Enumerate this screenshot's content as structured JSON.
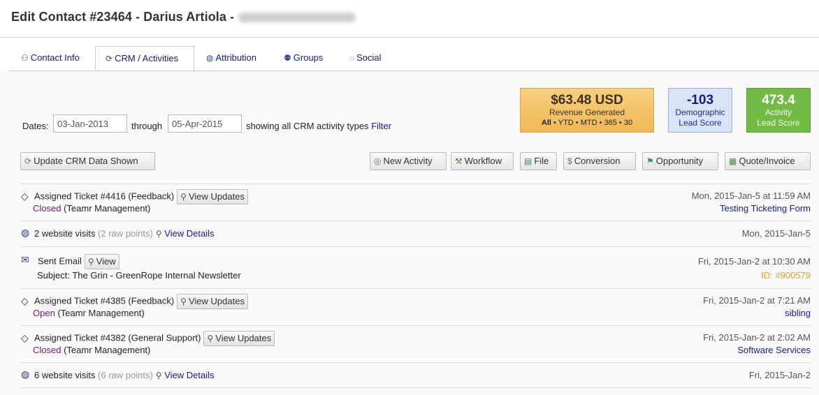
{
  "page": {
    "title": "Edit Contact #23464 - Darius Artiola -"
  },
  "tabs": [
    {
      "label": "Contact Info",
      "icon": "person-icon",
      "active": false
    },
    {
      "label": "CRM / Activities",
      "icon": "crm-icon",
      "active": true
    },
    {
      "label": "Attribution",
      "icon": "globe-icon",
      "active": false
    },
    {
      "label": "Groups",
      "icon": "group-icon",
      "active": false
    },
    {
      "label": "Social",
      "icon": "chat-icon",
      "active": false
    }
  ],
  "stats": {
    "revenue": {
      "value": "$63.48 USD",
      "label": "Revenue Generated",
      "periods_all": "All",
      "periods_rest": "• YTD • MTD • 365 • 30"
    },
    "demographic": {
      "value": "-103",
      "line1": "Demographic",
      "line2": "Lead Score"
    },
    "activity": {
      "value": "473.4",
      "line1": "Activity",
      "line2": "Lead Score"
    }
  },
  "filter": {
    "dates_label": "Dates:",
    "from": "03-Jan-2013",
    "through_label": "through",
    "to": "05-Apr-2015",
    "showing": "showing all CRM activity types",
    "filter_link": "Filter"
  },
  "toolbar": {
    "update": "Update CRM Data Shown",
    "new_activity": "New Activity",
    "workflow": "Workflow",
    "file": "File",
    "conversion": "Conversion",
    "opportunity": "Opportunity",
    "quote": "Quote/Invoice"
  },
  "feed": [
    {
      "title": "Assigned Ticket #4416 (Feedback)",
      "button": "View Updates",
      "status": "Closed",
      "status_rest": "(Teamr Management)",
      "date": "Mon, 2015-Jan-5 at 11:59 AM",
      "right_link": "Testing Ticketing Form"
    },
    {
      "title": "2 website visits",
      "muted": "(2 raw points)",
      "link": "View Details",
      "date": "Mon, 2015-Jan-5"
    },
    {
      "title": "Sent Email",
      "button": "View",
      "subject": "Subject: The Grin - GreenRope Internal Newsletter",
      "date": "Fri, 2015-Jan-2 at 10:30 AM",
      "id": "ID: #900579"
    },
    {
      "title": "Assigned Ticket #4385 (Feedback)",
      "button": "View Updates",
      "status": "Open",
      "status_rest": "(Teamr Management)",
      "date": "Fri, 2015-Jan-2 at 7:21 AM",
      "right_link": "sibling"
    },
    {
      "title": "Assigned Ticket #4382 (General Support)",
      "button": "View Updates",
      "status": "Closed",
      "status_rest": "(Teamr Management)",
      "date": "Fri, 2015-Jan-2 at 2:02 AM",
      "right_link": "Software Services"
    },
    {
      "title": "6 website visits",
      "muted": "(6 raw points)",
      "link": "View Details",
      "date": "Fri, 2015-Jan-2"
    }
  ]
}
